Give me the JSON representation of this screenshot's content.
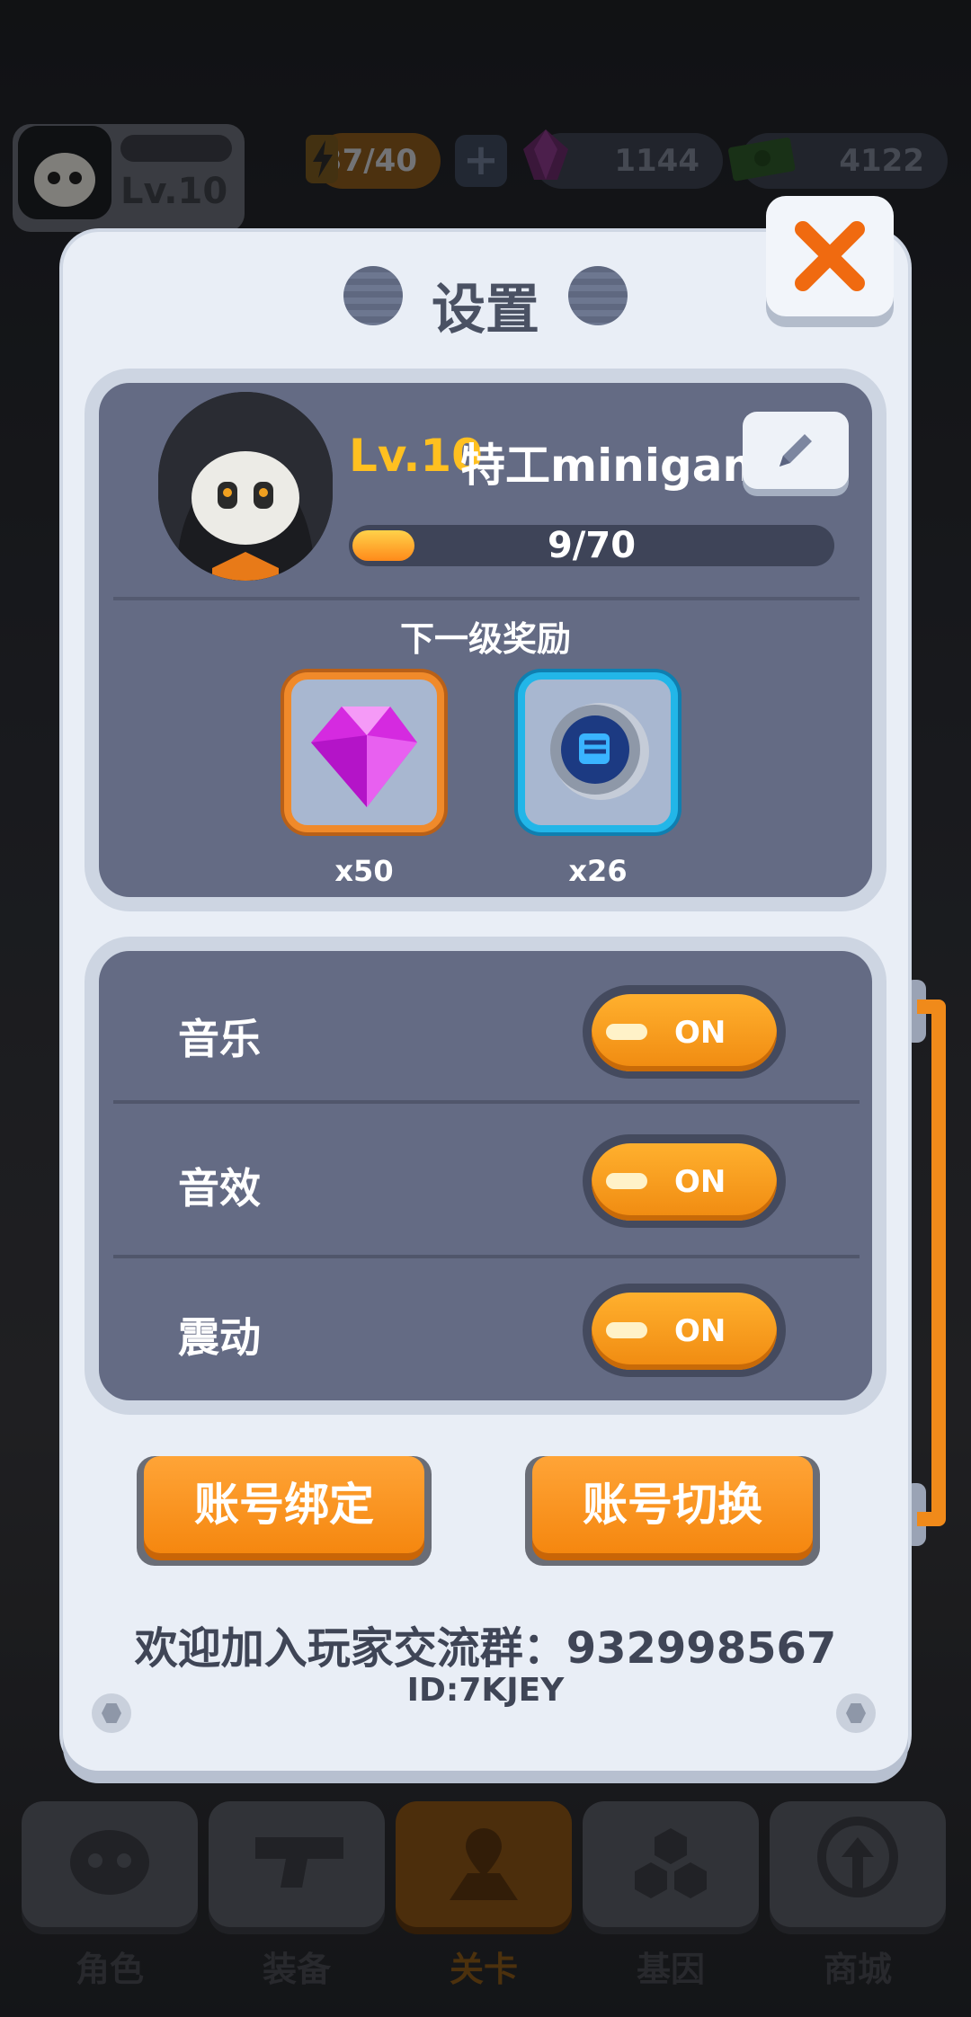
{
  "hud": {
    "player_level": "Lv.10",
    "energy": "37/40",
    "gems": "1144",
    "cash": "4122"
  },
  "dialog": {
    "title": "设置",
    "profile": {
      "level": "Lv.10",
      "name": "特工minigame",
      "xp": "9/70",
      "xp_fraction": 0.13
    },
    "next_reward_title": "下一级奖励",
    "rewards": [
      {
        "icon": "gem-icon",
        "qty": "x50"
      },
      {
        "icon": "fist-token-icon",
        "qty": "x26"
      }
    ],
    "settings": [
      {
        "label": "音乐",
        "state": "ON"
      },
      {
        "label": "音效",
        "state": "ON"
      },
      {
        "label": "震动",
        "state": "ON"
      }
    ],
    "buttons": {
      "bind": "账号绑定",
      "switch": "账号切换"
    },
    "welcome": "欢迎加入玩家交流群：932998567",
    "uid": "ID:7KJEY"
  },
  "nav": [
    "角色",
    "装备",
    "关卡",
    "基因",
    "商城"
  ],
  "colors": {
    "accent_orange": "#f5870f",
    "level_gold": "#ffc020",
    "panel_bg": "#e9eef6",
    "card_bg": "#646b84"
  }
}
